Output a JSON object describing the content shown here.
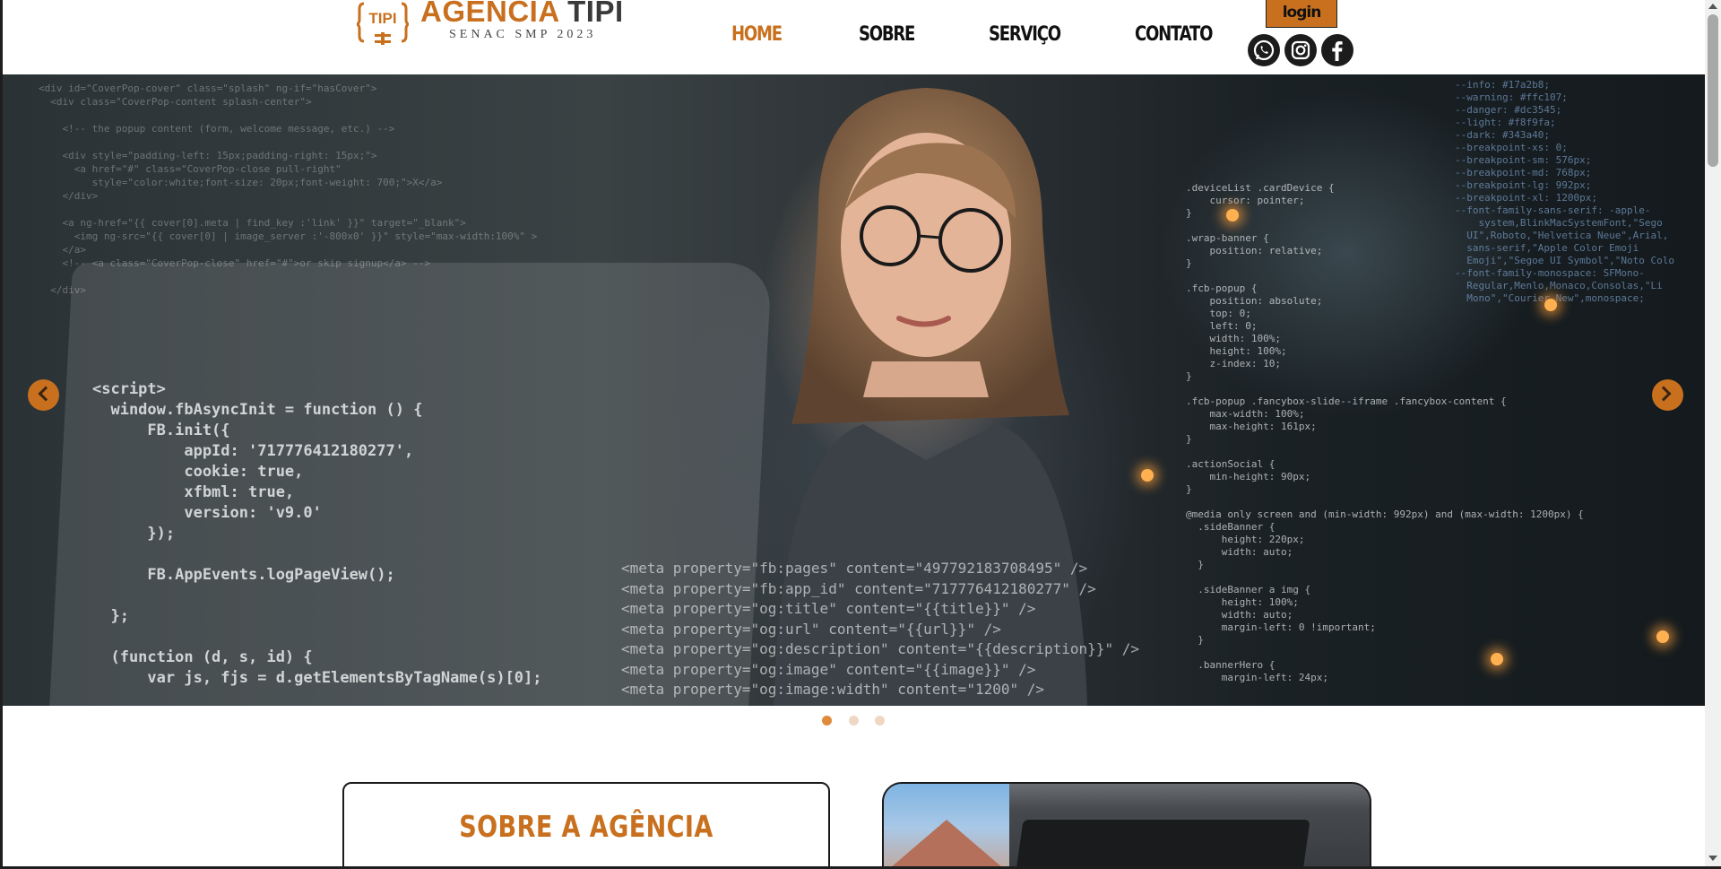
{
  "header": {
    "logo": {
      "badge_text": "TIPI",
      "title_part1": "AGÊNCIA",
      "title_part2": "TIPI",
      "subtitle": "SENAC SMP 2023"
    },
    "nav": [
      {
        "label": "HOME",
        "active": true
      },
      {
        "label": "SOBRE",
        "active": false
      },
      {
        "label": "SERVIÇO",
        "active": false
      },
      {
        "label": "CONTATO",
        "active": false
      }
    ],
    "login_label": "login",
    "social": [
      {
        "name": "whatsapp-icon"
      },
      {
        "name": "instagram-icon"
      },
      {
        "name": "facebook-icon"
      }
    ]
  },
  "hero": {
    "slides_total": 3,
    "active_slide": 1,
    "prev_icon": "chevron-left-icon",
    "next_icon": "chevron-right-icon",
    "code_main": "<script>\n  window.fbAsyncInit = function () {\n      FB.init({\n          appId: '717776412180277',\n          cookie: true,\n          xfbml: true,\n          version: 'v9.0'\n      });\n\n      FB.AppEvents.logPageView();\n\n  };\n\n  (function (d, s, id) {\n      var js, fjs = d.getElementsByTagName(s)[0];",
    "code_meta": "<meta property=\"fb:pages\" content=\"497792183708495\" />\n<meta property=\"fb:app_id\" content=\"717776412180277\" />\n<meta property=\"og:title\" content=\"{{title}}\" />\n<meta property=\"og:url\" content=\"{{url}}\" />\n<meta property=\"og:description\" content=\"{{description}}\" />\n<meta property=\"og:image\" content=\"{{image}}\" />\n<meta property=\"og:image:width\" content=\"1200\" />",
    "code_top": "<div id=\"CoverPop-cover\" class=\"splash\" ng-if=\"hasCover\">\n  <div class=\"CoverPop-content splash-center\">\n\n    <!-- the popup content (form, welcome message, etc.) -->\n\n    <div style=\"padding-left: 15px;padding-right: 15px;\">\n      <a href=\"#\" class=\"CoverPop-close pull-right\"\n         style=\"color:white;font-size: 20px;font-weight: 700;\">X</a>\n    </div>\n\n    <a ng-href=\"{{ cover[0].meta | find_key :'link' }}\" target=\"_blank\">\n      <img ng-src=\"{{ cover[0] | image_server :'-800x0' }}\" style=\"max-width:100%\" >\n    </a>\n    <!-- <a class=\"CoverPop-close\" href=\"#\">or skip signup</a> -->\n\n  </div>",
    "code_css": ".deviceList .cardDevice {\n    cursor: pointer;\n}\n\n.wrap-banner {\n    position: relative;\n}\n\n.fcb-popup {\n    position: absolute;\n    top: 0;\n    left: 0;\n    width: 100%;\n    height: 100%;\n    z-index: 10;\n}\n\n.fcb-popup .fancybox-slide--iframe .fancybox-content {\n    max-width: 100%;\n    max-height: 161px;\n}\n\n.actionSocial {\n    min-height: 90px;\n}\n\n@media only screen and (min-width: 992px) and (max-width: 1200px) {\n  .sideBanner {\n      height: 220px;\n      width: auto;\n  }\n\n  .sideBanner a img {\n      height: 100%;\n      width: auto;\n      margin-left: 0 !important;\n  }\n\n  .bannerHero {\n      margin-left: 24px;",
    "code_vars": "--info: #17a2b8;\n--warning: #ffc107;\n--danger: #dc3545;\n--light: #f8f9fa;\n--dark: #343a40;\n--breakpoint-xs: 0;\n--breakpoint-sm: 576px;\n--breakpoint-md: 768px;\n--breakpoint-lg: 992px;\n--breakpoint-xl: 1200px;\n--font-family-sans-serif: -apple-\n    system,BlinkMacSystemFont,\"Sego\n  UI\",Roboto,\"Helvetica Neue\",Arial,\n  sans-serif,\"Apple Color Emoji\n  Emoji\",\"Segoe UI Symbol\",\"Noto Colo\n--font-family-monospace: SFMono-\n  Regular,Menlo,Monaco,Consolas,\"Li\n  Mono\",\"Courier New\",monospace;"
  },
  "about": {
    "title": "SOBRE A AGÊNCIA"
  },
  "colors": {
    "brand_orange": "#c8701e",
    "dark": "#1c1c1c",
    "dot_inactive": "#efd7c4",
    "dot_active": "#e08a3c"
  }
}
